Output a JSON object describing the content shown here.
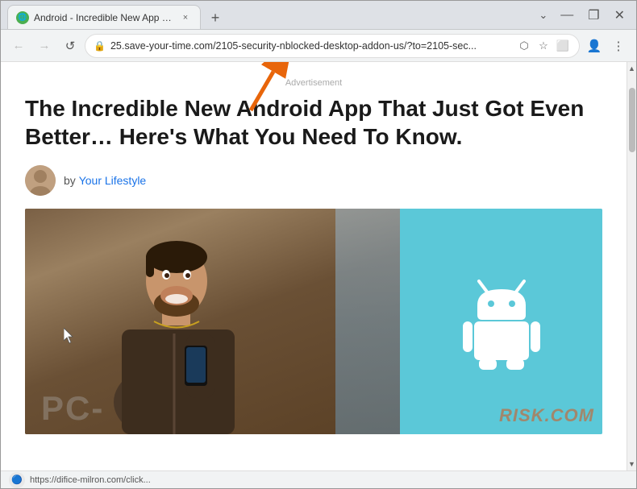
{
  "window": {
    "title": "Android - Incredible New App - ...",
    "favicon": "🌐",
    "tab_close": "×",
    "new_tab": "+",
    "controls": {
      "minimize": "—",
      "restore": "❐",
      "close": "✕"
    }
  },
  "nav": {
    "back_label": "←",
    "forward_label": "→",
    "refresh_label": "↺",
    "url": "25.save-your-time.com/2105-security-nblocked-desktop-addon-us/?to=2105-sec...",
    "share_label": "⬡",
    "bookmark_label": "☆",
    "extensions_label": "⬜",
    "profile_label": "👤",
    "menu_label": "⋮"
  },
  "page": {
    "ad_label": "Advertisement",
    "article_title": "The Incredible New Android App That Just Got Even Better… Here's What You Need To Know.",
    "author_prefix": "by",
    "author_name": "Your Lifestyle",
    "watermark": "RISK.COM",
    "pc_watermark": "PC-"
  },
  "status_bar": {
    "url": "https://difice-milron.com/click...",
    "icon": "🔵"
  }
}
